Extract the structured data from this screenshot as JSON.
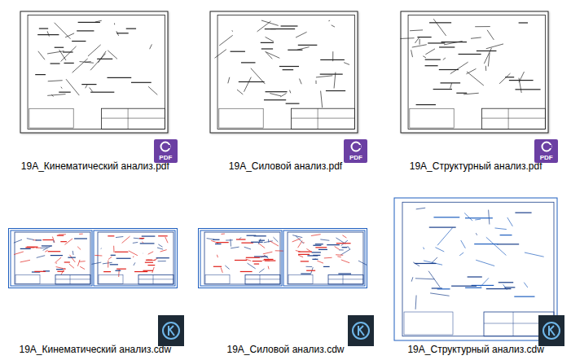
{
  "files": [
    {
      "label": "19A_Кинематический анализ.pdf",
      "kind": "pdf",
      "preview": "single",
      "badge": "PDF",
      "selected": false
    },
    {
      "label": "19A_Силовой анализ.pdf",
      "kind": "pdf",
      "preview": "single",
      "badge": "PDF",
      "selected": false
    },
    {
      "label": "19A_Структурный анализ.pdf",
      "kind": "pdf",
      "preview": "single",
      "badge": "PDF",
      "selected": false
    },
    {
      "label": "19A_Кинематический анализ.cdw",
      "kind": "cdw",
      "preview": "double",
      "badge": "",
      "selected": false
    },
    {
      "label": "19A_Силовой анализ.cdw",
      "kind": "cdw",
      "preview": "double",
      "badge": "",
      "selected": false
    },
    {
      "label": "19A_Структурный анализ.cdw",
      "kind": "cdw",
      "preview": "large",
      "badge": "",
      "selected": false
    }
  ]
}
